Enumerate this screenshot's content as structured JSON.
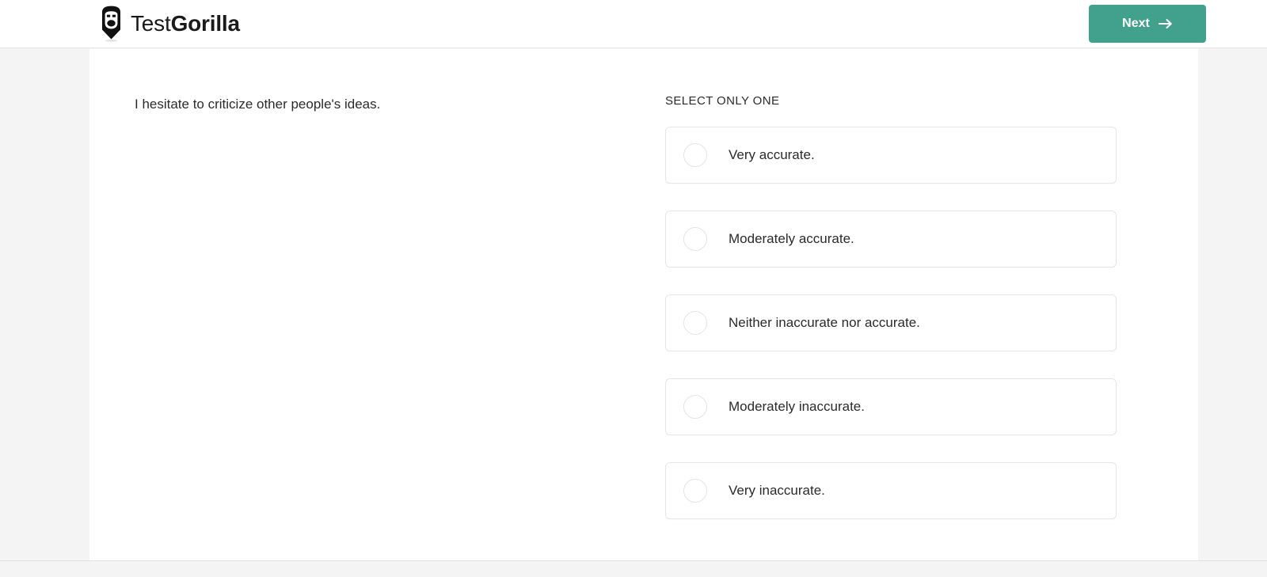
{
  "header": {
    "brand": {
      "logo_icon": "testgorilla-gorilla-pencil-icon",
      "name_light": "Test",
      "name_bold": "Gorilla"
    },
    "next_button": {
      "label": "Next",
      "icon": "arrow-right-icon",
      "color": "#41a18d",
      "text_color": "#ffffff"
    }
  },
  "main": {
    "question": "I hesitate to criticize other people's ideas.",
    "select_hint": "SELECT ONLY ONE",
    "options": [
      {
        "label": "Very accurate.",
        "selected": false
      },
      {
        "label": "Moderately accurate.",
        "selected": false
      },
      {
        "label": "Neither inaccurate nor accurate.",
        "selected": false
      },
      {
        "label": "Moderately inaccurate.",
        "selected": false
      },
      {
        "label": "Very inaccurate.",
        "selected": false
      }
    ]
  },
  "theme": {
    "page_background": "#f4f4f4",
    "panel_background": "#ffffff",
    "text_color": "#2b2b2b",
    "card_border": "#e6e6e6",
    "accent": "#41a18d"
  }
}
